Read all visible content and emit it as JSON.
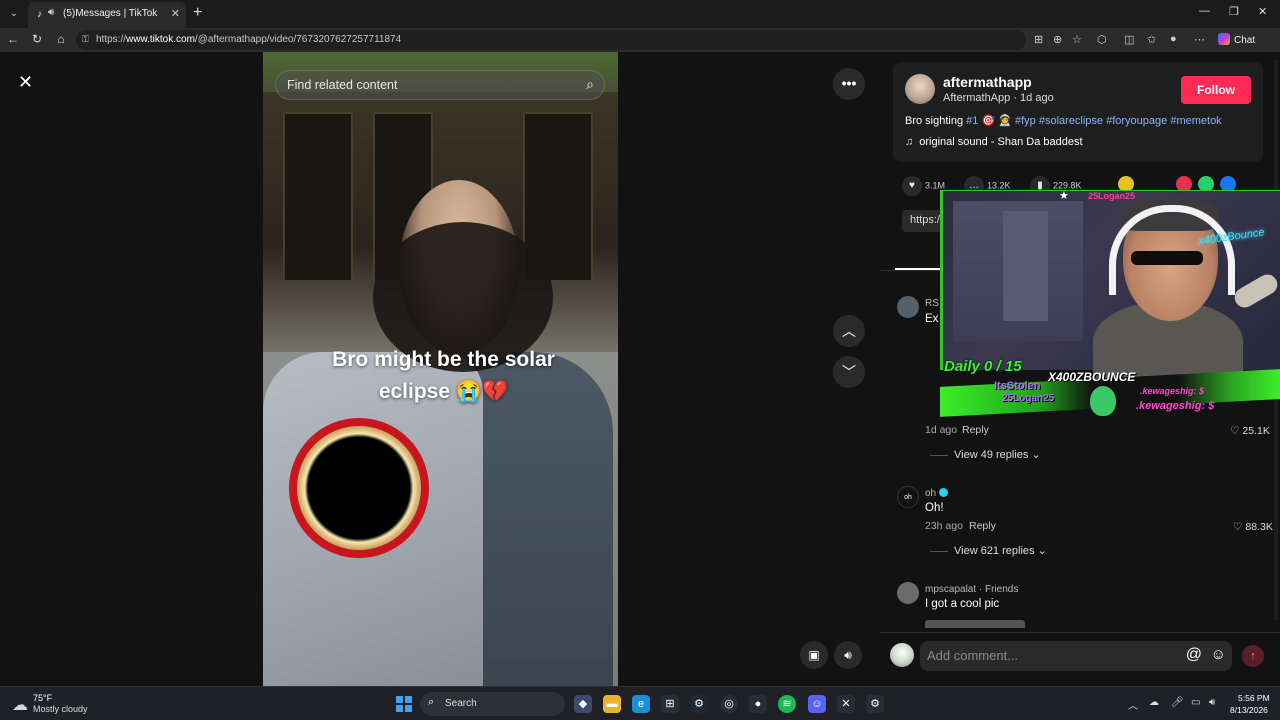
{
  "browser": {
    "tab_title": "(5)Messages | TikTok",
    "url_prefix": "https://",
    "url_domain": "www.tiktok.com",
    "url_path": "/@aftermathapp/video/7673207627257711874",
    "chat_label": "Chat"
  },
  "video": {
    "search_placeholder": "Find related content",
    "caption": "Bro might be the solar eclipse 😭💔"
  },
  "author": {
    "username": "aftermathapp",
    "display_name": "AftermathApp",
    "posted": "1d ago",
    "follow_label": "Follow",
    "description_prefix": "Bro sighting ",
    "rank_tag": "#1",
    "hashtags": [
      "#fyp",
      "#solareclipse",
      "#foryoupage",
      "#memetok"
    ],
    "music": "original sound - Shan Da baddest"
  },
  "stats": {
    "likes": "3.1M",
    "comments": "13.2K",
    "saves": "229.8K",
    "link_prefix": "https:/"
  },
  "comments": [
    {
      "user": "RS",
      "text": "Ex",
      "time": "1d ago",
      "reply_label": "Reply",
      "likes": "25.1K",
      "view_replies": "View 49 replies"
    },
    {
      "avatar_text": "oh",
      "user": "oh",
      "text": "Oh!",
      "time": "23h ago",
      "reply_label": "Reply",
      "likes": "88.3K",
      "view_replies": "View 621 replies"
    },
    {
      "user": "mpscapalat · Friends",
      "text": "I got a cool pic"
    }
  ],
  "comment_bar": {
    "placeholder": "Add comment..."
  },
  "stream_overlay": {
    "top_user": "25Logan25",
    "neon_sign": "x400zBounce",
    "daily": "Daily 0 / 15",
    "brand": "X400ZBOUNCE",
    "follower_1": "ItsStolen",
    "follower_2": "25Logan25",
    "tip_1": ".kewageshig: $",
    "tip_2": ".kewageshig: $"
  },
  "taskbar": {
    "temperature": "75°F",
    "weather": "Mostly cloudy",
    "search_label": "Search",
    "time": "5:56 PM",
    "date": "8/13/2026"
  },
  "colors": {
    "accent": "#fe2c55",
    "hashtag": "#8ab4f8",
    "stream_green": "#3cf02a"
  }
}
